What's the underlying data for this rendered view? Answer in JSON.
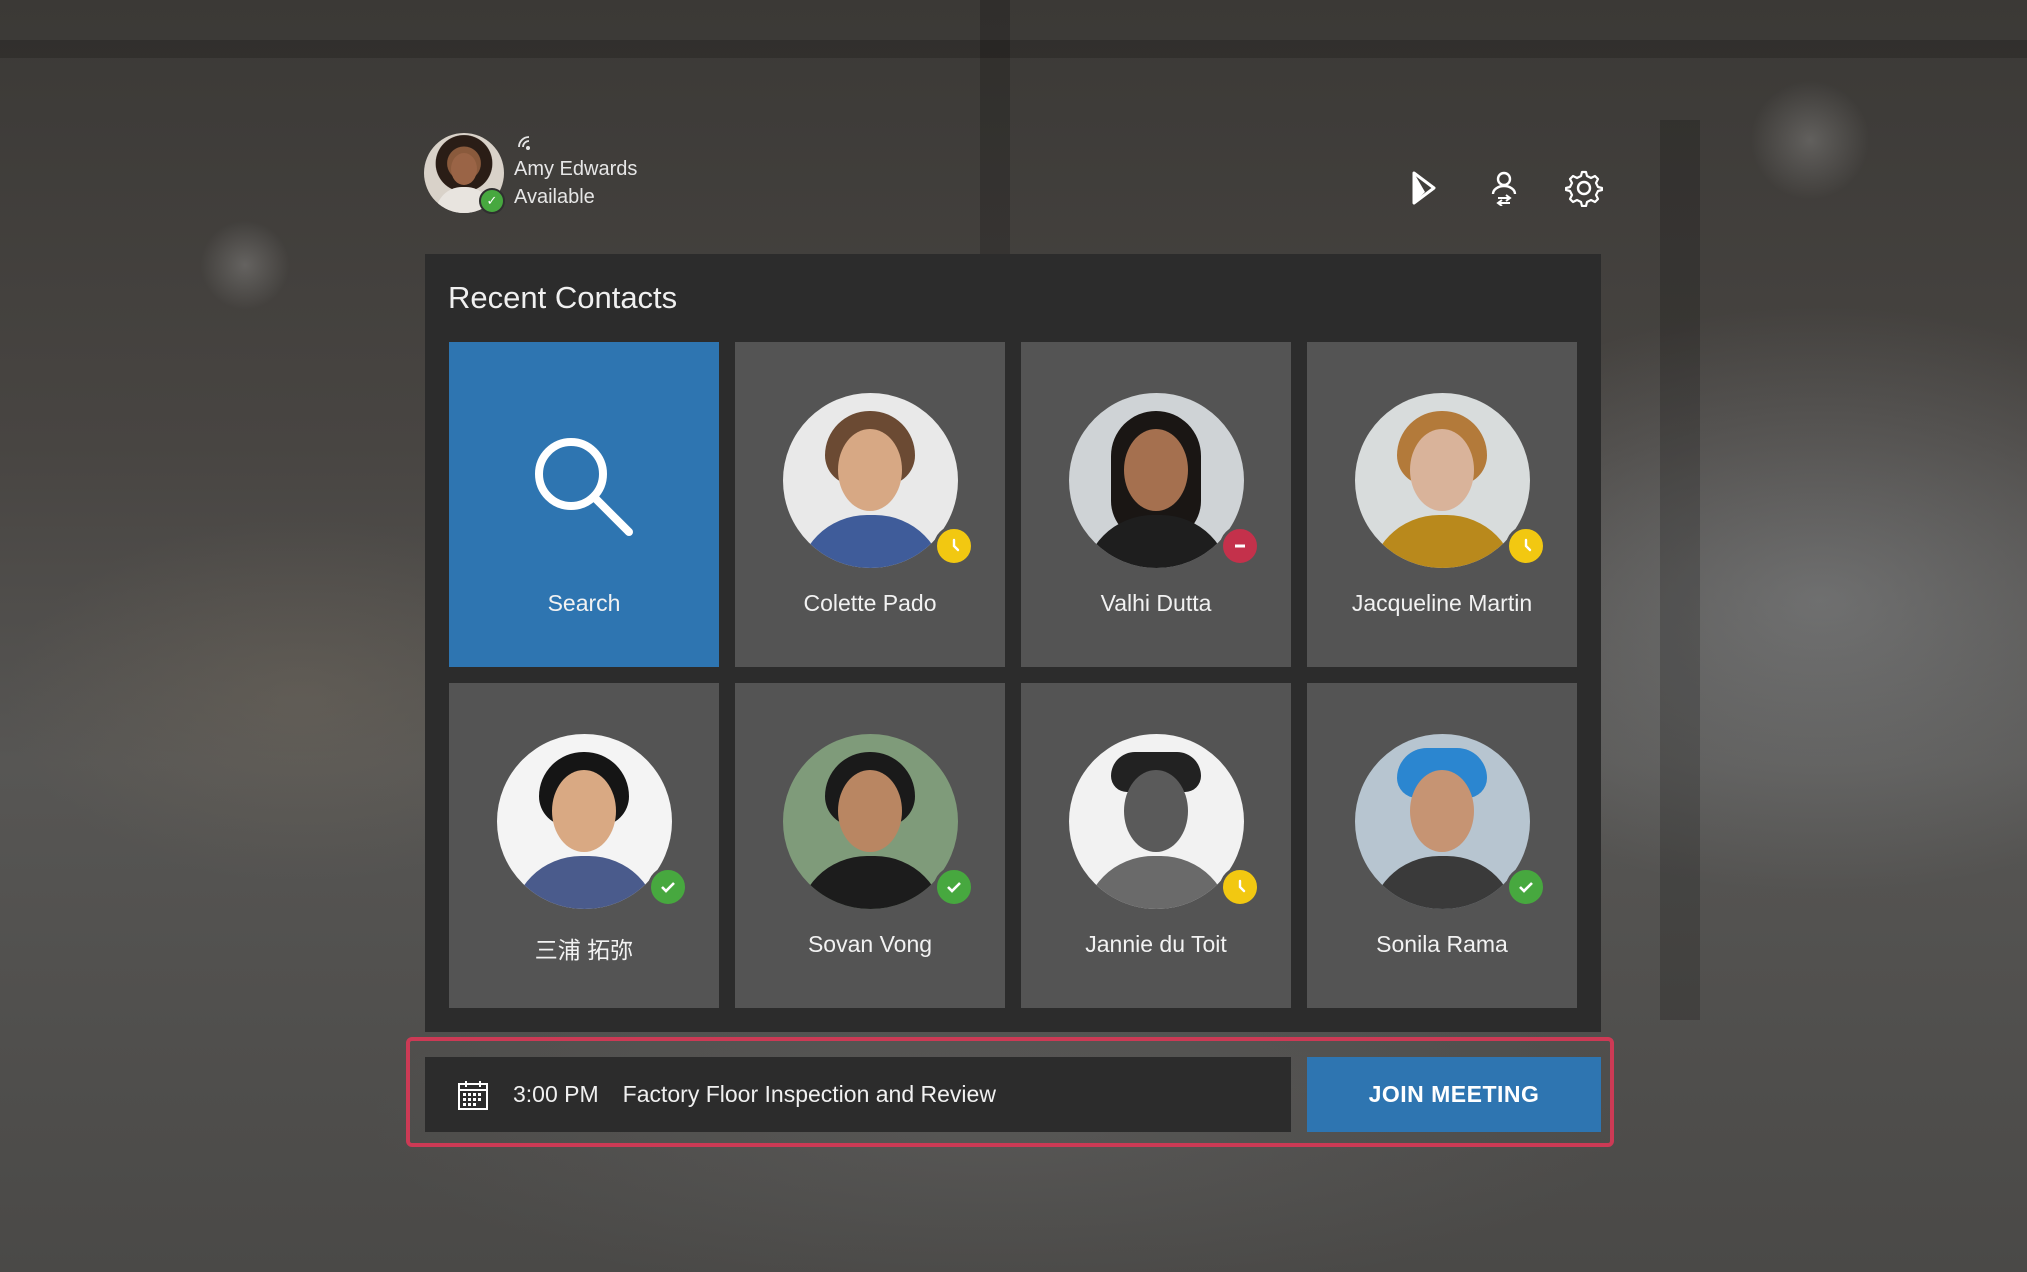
{
  "user": {
    "name": "Amy Edwards",
    "status": "Available",
    "status_color": "#47a83f"
  },
  "toolbar": {
    "icons": [
      "dynamics-icon",
      "contact-switch-icon",
      "gear-icon"
    ]
  },
  "recent_contacts": {
    "title": "Recent Contacts",
    "search_label": "Search",
    "contacts": [
      {
        "name": "Colette Pado",
        "status": "away"
      },
      {
        "name": "Valhi Dutta",
        "status": "busy"
      },
      {
        "name": "Jacqueline Martin",
        "status": "away"
      },
      {
        "name": "三浦 拓弥",
        "status": "available"
      },
      {
        "name": "Sovan Vong",
        "status": "available"
      },
      {
        "name": "Jannie du Toit",
        "status": "away"
      },
      {
        "name": "Sonila Rama",
        "status": "available"
      }
    ]
  },
  "meeting": {
    "time": "3:00 PM",
    "title": "Factory Floor Inspection and Review",
    "join_label": "JOIN MEETING"
  },
  "colors": {
    "accent": "#2e75b1",
    "highlight": "#cc3a55",
    "available": "#47a83f",
    "away": "#f2c811",
    "busy": "#c4314b"
  }
}
